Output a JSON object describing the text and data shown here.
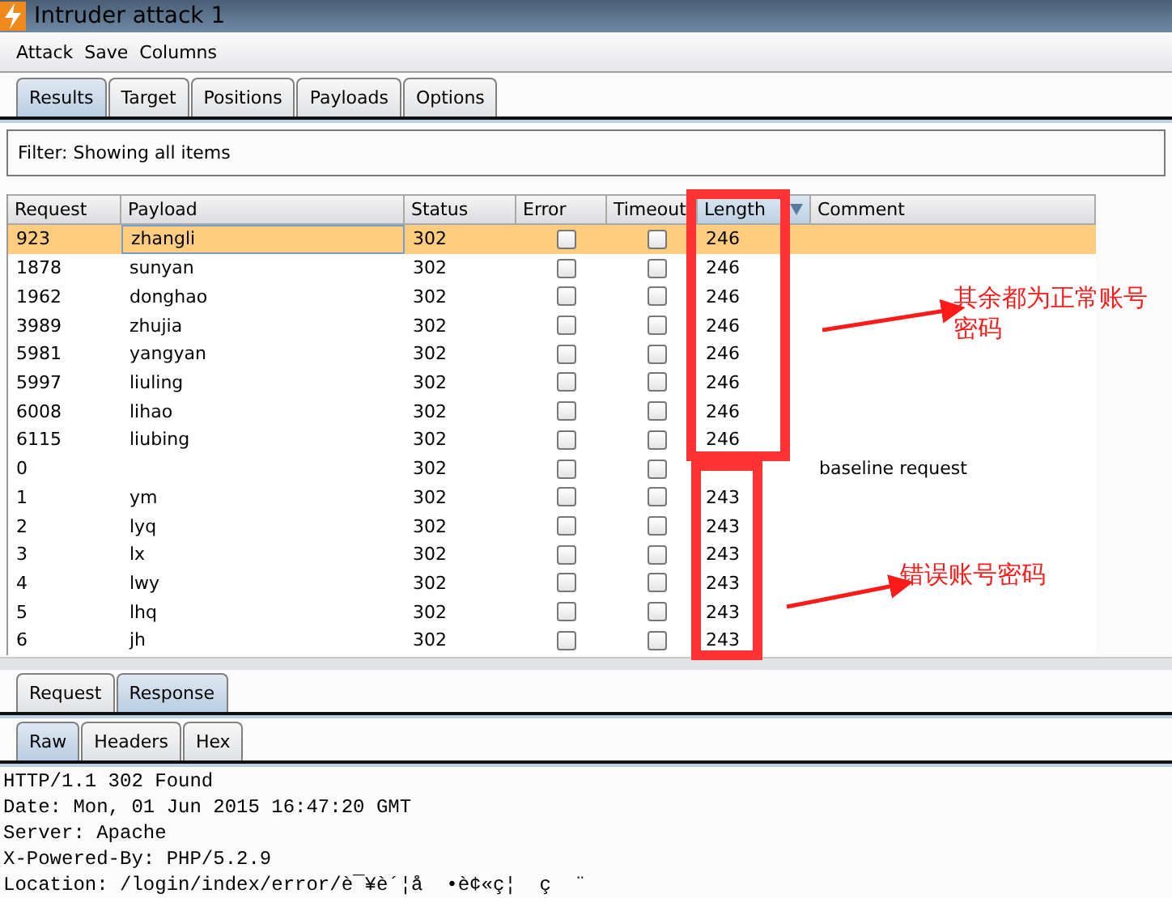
{
  "window": {
    "title": "Intruder attack 1"
  },
  "menu": [
    "Attack",
    "Save",
    "Columns"
  ],
  "tabs": [
    {
      "label": "Results",
      "selected": true
    },
    {
      "label": "Target",
      "selected": false
    },
    {
      "label": "Positions",
      "selected": false
    },
    {
      "label": "Payloads",
      "selected": false
    },
    {
      "label": "Options",
      "selected": false
    }
  ],
  "filter": "Filter:  Showing all items",
  "table": {
    "columns": [
      {
        "label": "Request",
        "sorted": false
      },
      {
        "label": "Payload",
        "sorted": false
      },
      {
        "label": "Status",
        "sorted": false
      },
      {
        "label": "Error",
        "sorted": false
      },
      {
        "label": "Timeout",
        "sorted": false
      },
      {
        "label": "Length",
        "sorted": true
      },
      {
        "label": "Comment",
        "sorted": false
      }
    ],
    "rows": [
      {
        "request": "923",
        "payload": "zhangli",
        "status": "302",
        "error": false,
        "timeout": false,
        "length": "246",
        "selected": true
      },
      {
        "request": "1878",
        "payload": "sunyan",
        "status": "302",
        "error": false,
        "timeout": false,
        "length": "246",
        "selected": false
      },
      {
        "request": "1962",
        "payload": "donghao",
        "status": "302",
        "error": false,
        "timeout": false,
        "length": "246",
        "selected": false
      },
      {
        "request": "3989",
        "payload": "zhujia",
        "status": "302",
        "error": false,
        "timeout": false,
        "length": "246",
        "selected": false
      },
      {
        "request": "5981",
        "payload": "yangyan",
        "status": "302",
        "error": false,
        "timeout": false,
        "length": "246",
        "selected": false
      },
      {
        "request": "5997",
        "payload": "liuling",
        "status": "302",
        "error": false,
        "timeout": false,
        "length": "246",
        "selected": false
      },
      {
        "request": "6008",
        "payload": "lihao",
        "status": "302",
        "error": false,
        "timeout": false,
        "length": "246",
        "selected": false
      },
      {
        "request": "6115",
        "payload": "liubing",
        "status": "302",
        "error": false,
        "timeout": false,
        "length": "246",
        "selected": false
      },
      {
        "request": "0",
        "status": "302",
        "error": false,
        "timeout": false,
        "comment": "baseline request",
        "selected": false
      },
      {
        "request": "1",
        "payload": "ym",
        "status": "302",
        "error": false,
        "timeout": false,
        "length": "243",
        "selected": false
      },
      {
        "request": "2",
        "payload": "lyq",
        "status": "302",
        "error": false,
        "timeout": false,
        "length": "243",
        "selected": false
      },
      {
        "request": "3",
        "payload": "lx",
        "status": "302",
        "error": false,
        "timeout": false,
        "length": "243",
        "selected": false
      },
      {
        "request": "4",
        "payload": "lwy",
        "status": "302",
        "error": false,
        "timeout": false,
        "length": "243",
        "selected": false
      },
      {
        "request": "5",
        "payload": "lhq",
        "status": "302",
        "error": false,
        "timeout": false,
        "length": "243",
        "selected": false
      },
      {
        "request": "6",
        "payload": "jh",
        "status": "302",
        "error": false,
        "timeout": false,
        "length": "243",
        "selected": false
      }
    ]
  },
  "message_tabs": [
    {
      "label": "Request",
      "selected": false
    },
    {
      "label": "Response",
      "selected": true
    }
  ],
  "view_tabs": [
    {
      "label": "Raw",
      "selected": true
    },
    {
      "label": "Headers",
      "selected": false
    },
    {
      "label": "Hex",
      "selected": false
    }
  ],
  "response_lines": [
    "HTTP/1.1 302 Found",
    "Date: Mon, 01 Jun 2015 16:47:20 GMT",
    "Server: Apache",
    "X-Powered-By: PHP/5.2.9",
    "Location: /login/index/error/è¯¥è´¦å  •è¢«ç¦  ç  ¨"
  ],
  "annotations": [
    {
      "text": "其余都为正常账号密码"
    },
    {
      "text": "错误账号密码"
    }
  ]
}
